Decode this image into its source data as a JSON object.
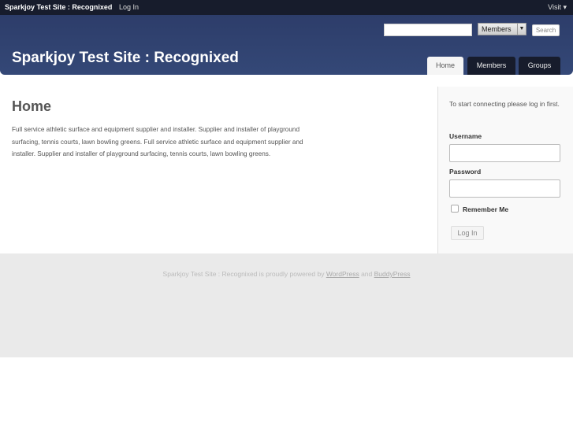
{
  "adminbar": {
    "site": "Sparkjoy Test Site : Recognixed",
    "login": "Log In",
    "visit": "Visit ▾"
  },
  "header": {
    "title": "Sparkjoy Test Site : Recognixed",
    "search_placeholder": "",
    "search_scope": "Members",
    "search_button": "Search",
    "tabs": [
      {
        "label": "Home"
      },
      {
        "label": "Members"
      },
      {
        "label": "Groups"
      }
    ]
  },
  "main": {
    "title": "Home",
    "text": "Full service athletic surface and equipment supplier and installer. Supplier and installer of playground surfacing, tennis courts, lawn bowling greens. Full service athletic surface and equipment supplier and installer. Supplier and installer of playground surfacing, tennis courts, lawn bowling greens."
  },
  "sidebar": {
    "intro": "To start connecting please log in first.",
    "username_label": "Username",
    "password_label": "Password",
    "remember_label": "Remember Me",
    "login_button": "Log In"
  },
  "footer": {
    "prefix": "Sparkjoy Test Site : Recognixed is proudly powered by ",
    "wordpress": "WordPress",
    "and": " and ",
    "buddypress": "BuddyPress"
  }
}
